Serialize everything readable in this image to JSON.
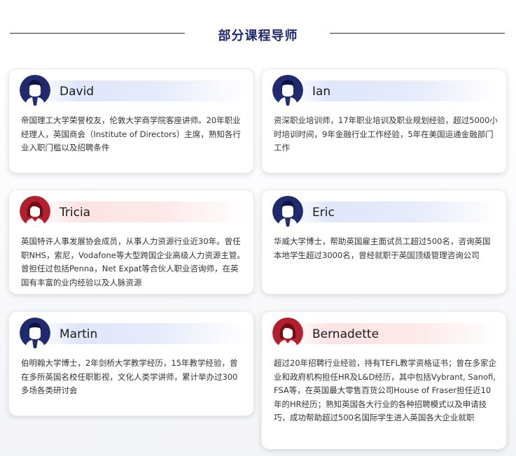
{
  "section_title": "部分课程导师",
  "colors": {
    "navy": "#1f2a6f",
    "red": "#b3202d",
    "text": "#333333"
  },
  "mentors": [
    {
      "name": "David",
      "avatar": "male-avatar-icon",
      "theme": "blue",
      "bio": "帝国理工大学荣誉校友，伦敦大学商学院客座讲师。20年职业经理人，英国商会（Institute of Directors）主席，熟知各行业入职门槛以及招聘条件"
    },
    {
      "name": "Ian",
      "avatar": "male-avatar-icon",
      "theme": "blue",
      "bio": "资深职业培训师，17年职业培训及职业规划经验，超过5000小时培训时间，9年金融行业工作经验，5年在美国运通金融部门工作"
    },
    {
      "name": "Tricia",
      "avatar": "female-avatar-icon",
      "theme": "red",
      "bio": "英国特许人事发展协会成员，从事人力资源行业近30年。曾任职NHS，索尼，Vodafone等大型跨国企业高级人力资源主管。曾担任过包括Penna，Net Expat等合伙人职业咨询师，在英国有丰富的业内经验以及人脉资源"
    },
    {
      "name": "Eric",
      "avatar": "male-avatar-icon",
      "theme": "blue",
      "bio": "华威大学博士，帮助英国雇主面试员工超过500名，咨询英国本地学生超过3000名，曾经就职于英国顶级管理咨询公司"
    },
    {
      "name": "Martin",
      "avatar": "male-avatar-icon",
      "theme": "blue",
      "bio": "伯明翰大学博士，2年剑桥大学教学经历，15年教学经验，曾在多所英国名校任职影视，文化人类学讲师，累计举办过300多场各类研讨会"
    },
    {
      "name": "Bernadette",
      "avatar": "female-avatar-icon",
      "theme": "red",
      "bio": "超过20年招聘行业经验，持有TEFL教学资格证书；曾在多家企业和政府机构担任HR及L&D经历，其中包括Vybrant, Sanofi, FSA等，在英国最大零售百货公司House of Fraser担任近10年的HR经历；熟知英国各大行业的各种招聘模式以及申请技巧，成功帮助超过500名国际学生进入英国各大企业就职"
    }
  ]
}
